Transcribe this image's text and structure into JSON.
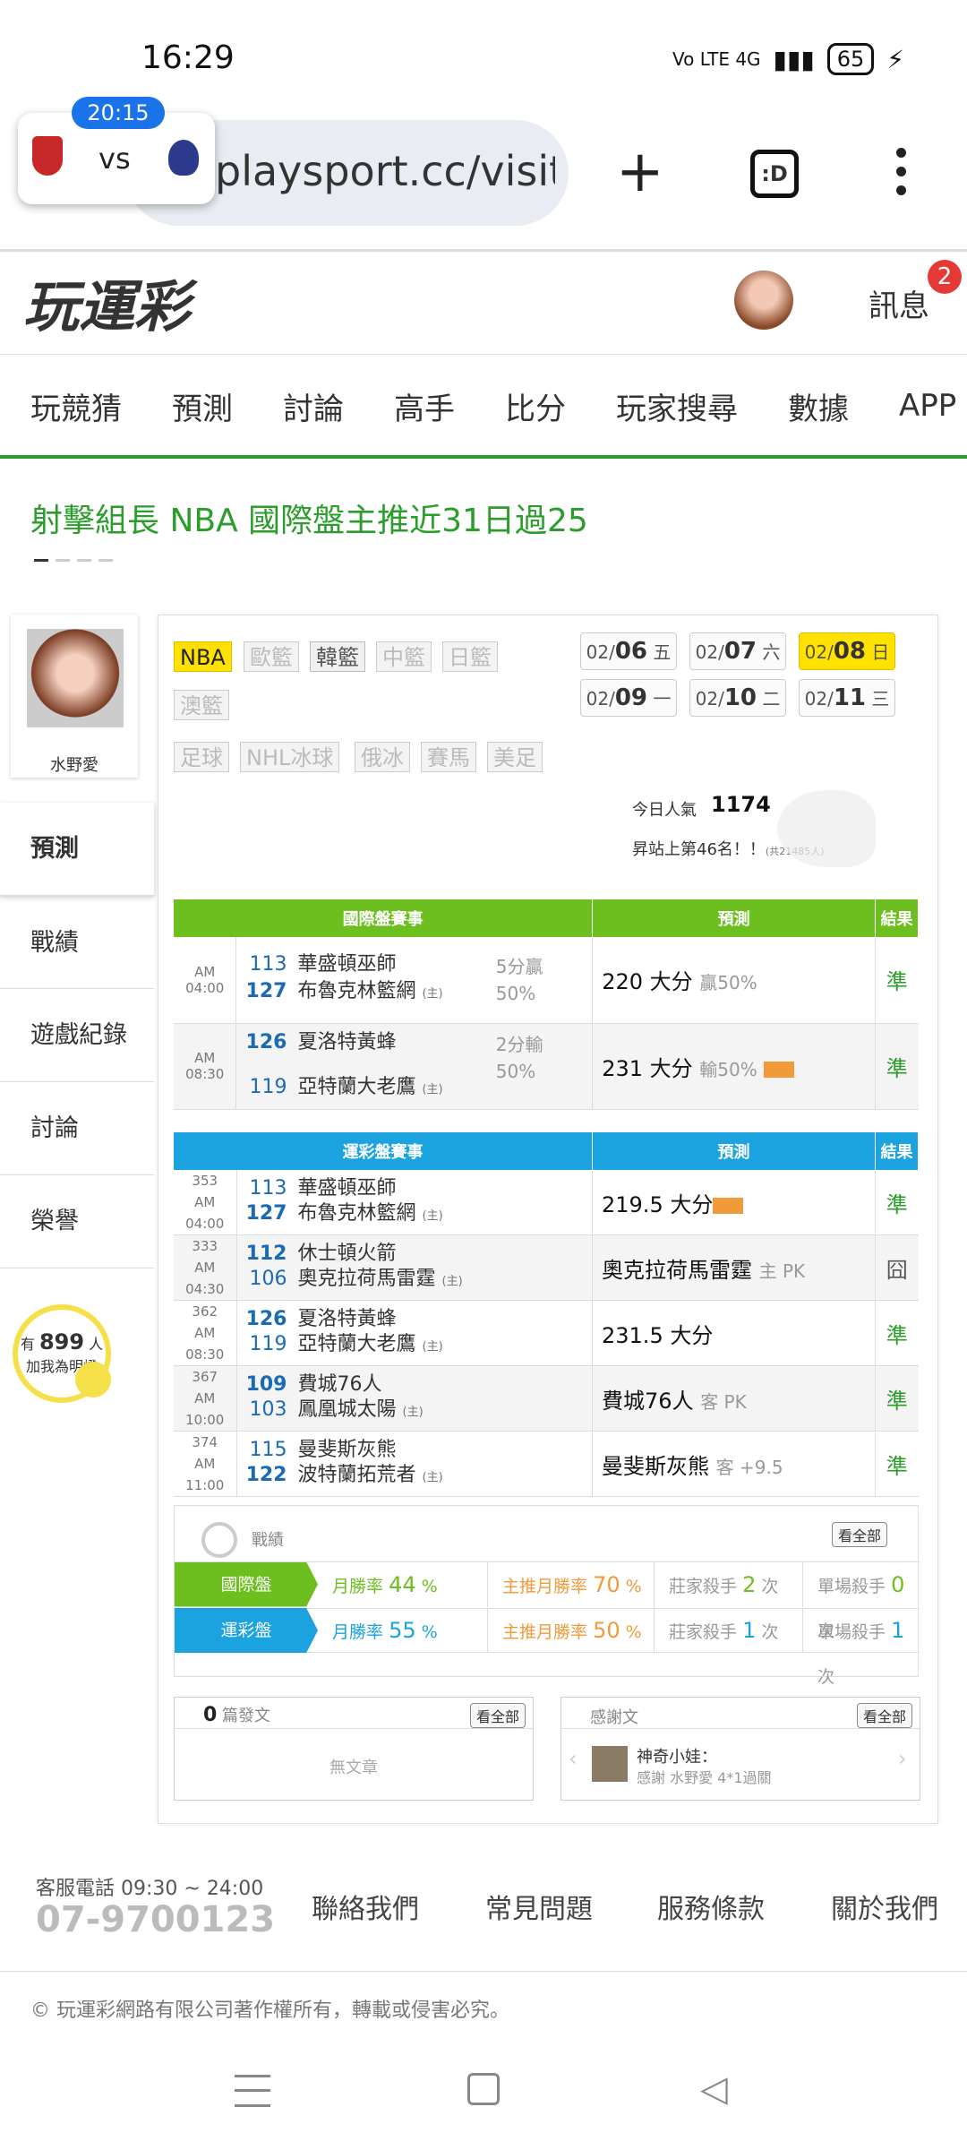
{
  "status_bar": {
    "time": "16:29",
    "network": "Vo LTE 4G",
    "battery": "65"
  },
  "browser": {
    "url": "playsport.cc/visit",
    "pip_time": "20:15",
    "pip_vs": "vs",
    "tabs_label": ":D"
  },
  "site": {
    "logo": "玩運彩",
    "messages_label": "訊息",
    "messages_count": "2"
  },
  "nav": [
    "玩競猜",
    "預測",
    "討論",
    "高手",
    "比分",
    "玩家搜尋",
    "數據",
    "APP"
  ],
  "headline": "射擊組長 NBA 國際盤主推近31日過25",
  "profile": {
    "name": "水野愛"
  },
  "sidebar": [
    "預測",
    "戰績",
    "遊戲紀錄",
    "討論",
    "榮譽"
  ],
  "fans": {
    "prefix": "有",
    "count": "899",
    "suffix": "人",
    "action": "加我為明燈"
  },
  "league_tags": [
    "NBA",
    "歐籃",
    "韓籃",
    "中籃",
    "日籃",
    "澳籃",
    "足球",
    "NHL冰球",
    "俄冰",
    "賽馬",
    "美足"
  ],
  "dates": [
    {
      "md": "02/",
      "d": "06",
      "w": "五"
    },
    {
      "md": "02/",
      "d": "07",
      "w": "六"
    },
    {
      "md": "02/",
      "d": "08",
      "w": "日"
    },
    {
      "md": "02/",
      "d": "09",
      "w": "一"
    },
    {
      "md": "02/",
      "d": "10",
      "w": "二"
    },
    {
      "md": "02/",
      "d": "11",
      "w": "三"
    }
  ],
  "popularity": {
    "label": "今日人氣",
    "value": "1174",
    "rank": "昇站上第46名！！",
    "rank_note": "(共21485人)"
  },
  "intl_table": {
    "headers": [
      "國際盤賽事",
      "預測",
      "結果"
    ],
    "rows": [
      {
        "time": "AM 04:00",
        "n1": "113",
        "t1": "華盛頓巫師",
        "n2": "127",
        "t2": "布魯克林籃網",
        "home": "(主)",
        "line": "5分贏",
        "line2": "50%",
        "pred": "220 大分",
        "pred_note": "贏50%",
        "res": "準"
      },
      {
        "time": "AM 08:30",
        "n1": "126",
        "t1": "夏洛特黃蜂",
        "n2": "119",
        "t2": "亞特蘭大老鷹",
        "home": "(主)",
        "line": "2分輸",
        "line2": "50%",
        "pred": "231 大分",
        "pred_note": "輸50%",
        "res": "準"
      }
    ]
  },
  "lottery_table": {
    "headers": [
      "運彩盤賽事",
      "預測",
      "結果"
    ],
    "rows": [
      {
        "id": "353",
        "time": "AM 04:00",
        "n1": "113",
        "t1": "華盛頓巫師",
        "n2": "127",
        "t2": "布魯克林籃網",
        "home": "(主)",
        "pred": "219.5 大分",
        "pred_note": "",
        "res": "準"
      },
      {
        "id": "333",
        "time": "AM 04:30",
        "n1": "112",
        "t1": "休士頓火箭",
        "n2": "106",
        "t2": "奧克拉荷馬雷霆",
        "home": "(主)",
        "pred": "奧克拉荷馬雷霆",
        "pred_note": "主 PK",
        "res": "囧"
      },
      {
        "id": "362",
        "time": "AM 08:30",
        "n1": "126",
        "t1": "夏洛特黃蜂",
        "n2": "119",
        "t2": "亞特蘭大老鷹",
        "home": "(主)",
        "pred": "231.5 大分",
        "pred_note": "",
        "res": "準"
      },
      {
        "id": "367",
        "time": "AM 10:00",
        "n1": "109",
        "t1": "費城76人",
        "n2": "103",
        "t2": "鳳凰城太陽",
        "home": "(主)",
        "pred": "費城76人",
        "pred_note": "客 PK",
        "res": "準"
      },
      {
        "id": "374",
        "time": "AM 11:00",
        "n1": "115",
        "t1": "曼斐斯灰熊",
        "n2": "122",
        "t2": "波特蘭拓荒者",
        "home": "(主)",
        "pred": "曼斐斯灰熊",
        "pred_note": "客 +9.5",
        "res": "準"
      }
    ]
  },
  "record": {
    "title": "戰績",
    "see_all": "看全部",
    "rows": [
      {
        "label": "國際盤",
        "month": "月勝率",
        "month_v": "44",
        "main": "主推月勝率",
        "main_v": "70",
        "banker": "莊家殺手",
        "banker_v": "2",
        "single": "單場殺手",
        "single_v": "0",
        "pct": "%",
        "times": "次"
      },
      {
        "label": "運彩盤",
        "month": "月勝率",
        "month_v": "55",
        "main": "主推月勝率",
        "main_v": "50",
        "banker": "莊家殺手",
        "banker_v": "1",
        "single": "單場殺手",
        "single_v": "1",
        "pct": "%",
        "times": "次"
      }
    ]
  },
  "posts": {
    "count": "0",
    "label": "篇發文",
    "see_all": "看全部",
    "empty": "無文章"
  },
  "thanks": {
    "title": "感謝文",
    "see_all": "看全部",
    "user": "神奇小娃：",
    "text": "感謝 水野愛 4*1過關"
  },
  "footer": {
    "service_label": "客服電話 09:30 ~ 24:00",
    "phone": "07-9700123",
    "links": [
      "聯絡我們",
      "常見問題",
      "服務條款",
      "關於我們"
    ],
    "copyright": "© 玩運彩網路有限公司著作權所有，轉載或侵害必究。"
  },
  "colors": {
    "brand_green": "#2a9d2a",
    "intl_header": "#6cbf1e",
    "lottery_header": "#1ba3e0",
    "highlight": "#ffe200"
  }
}
